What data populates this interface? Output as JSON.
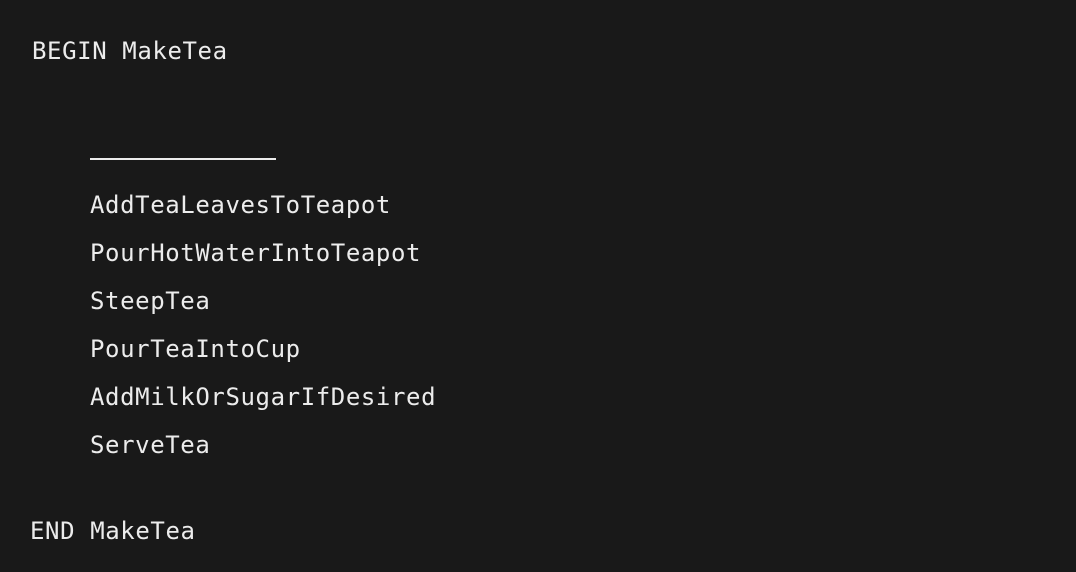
{
  "program": {
    "begin": "BEGIN MakeTea",
    "end": "END MakeTea",
    "blank_placeholder": "____________",
    "steps": [
      "AddTeaLeavesToTeapot",
      "PourHotWaterIntoTeapot",
      "SteepTea",
      "PourTeaIntoCup",
      "AddMilkOrSugarIfDesired",
      "ServeTea"
    ]
  },
  "colors": {
    "background": "#191919",
    "text": "#ececec"
  }
}
